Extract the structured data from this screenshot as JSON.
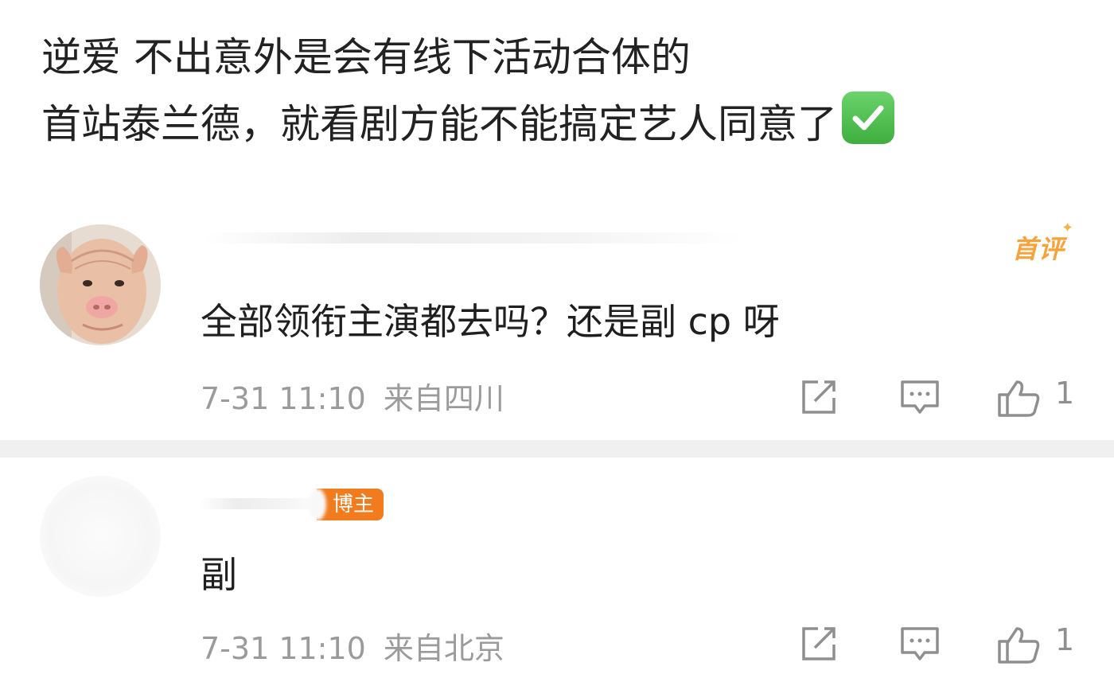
{
  "post": {
    "line1": "逆爱 不出意外是会有线下活动合体的",
    "line2": "首站泰兰德，就看剧方能不能搞定艺人同意了",
    "emoji": "check-mark-button"
  },
  "comments": [
    {
      "first_badge": "首评",
      "text": "全部领衔主演都去吗？还是副 cp 呀",
      "time": "7-31 11:10",
      "location": "来自四川",
      "likes": "1"
    },
    {
      "author_badge": "博主",
      "text": "副",
      "time": "7-31 11:10",
      "location": "来自北京",
      "likes": "1"
    }
  ],
  "icons": {
    "share": "share-icon",
    "reply": "comment-icon",
    "like": "thumbs-up-icon"
  },
  "colors": {
    "accent_orange": "#f27b1d",
    "first_comment_badge": "#f7a23b",
    "meta_gray": "#9b9b9b",
    "check_green": "#4cbf4c"
  }
}
